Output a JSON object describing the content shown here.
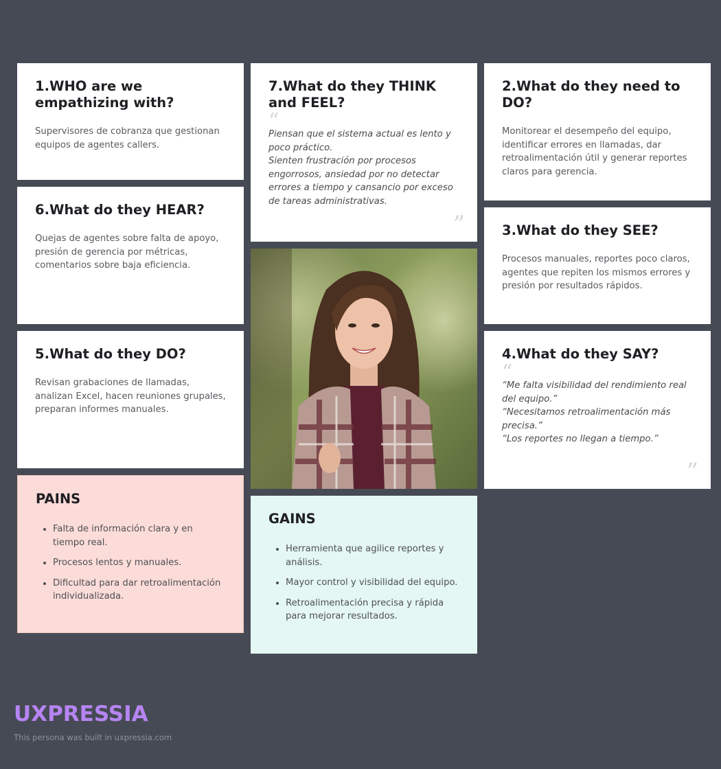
{
  "who": {
    "title": "1.WHO are we empathizing with?",
    "text": "Supervisores de cobranza que gestionan equipos de agentes callers."
  },
  "think_feel": {
    "title": "7.What do they THINK and FEEL?",
    "lines": [
      "Piensan que el sistema actual es lento y poco práctico.",
      "Sienten frustración por procesos engorrosos, ansiedad por no detectar errores a tiempo y cansancio por exceso de tareas administrativas."
    ]
  },
  "need_do": {
    "title": "2.What do they need to DO?",
    "text": "Monitorear el desempeño del equipo, identificar errores en llamadas, dar retroalimentación útil y generar reportes claros para gerencia."
  },
  "hear": {
    "title": "6.What do they HEAR?",
    "text": "Quejas de agentes sobre falta de apoyo, presión de gerencia por métricas, comentarios sobre baja eficiencia."
  },
  "see": {
    "title": "3.What do they SEE?",
    "text": "Procesos manuales, reportes poco claros, agentes que repiten los mismos errores y presión por resultados rápidos."
  },
  "do": {
    "title": "5.What do they DO?",
    "text": "Revisan grabaciones de llamadas, analizan Excel, hacen reuniones grupales, preparan informes manuales."
  },
  "say": {
    "title": "4.What do they SAY?",
    "lines": [
      "“Me falta visibilidad del rendimiento real del equipo.”",
      "“Necesitamos retroalimentación más precisa.”",
      "“Los reportes no llegan a tiempo.”"
    ]
  },
  "pains": {
    "title": "PAINS",
    "items": [
      "Falta de información clara y en tiempo real.",
      "Procesos lentos y manuales.",
      "Dificultad para dar retroalimentación individualizada."
    ]
  },
  "gains": {
    "title": "GAINS",
    "items": [
      "Herramienta que agilice reportes y análisis.",
      "Mayor control y visibilidad del equipo.",
      "Retroalimentación precisa y rápida para mejorar resultados."
    ]
  },
  "quote_marks": {
    "open": "“",
    "close": "”"
  },
  "footer": {
    "logo": "UXPRESSIA",
    "text": "This persona was built in uxpressia.com"
  },
  "colors": {
    "background": "#464a54",
    "pains_bg": "#fbdcd8",
    "gains_bg": "#e4f7f2",
    "logo": "#b584f2"
  }
}
